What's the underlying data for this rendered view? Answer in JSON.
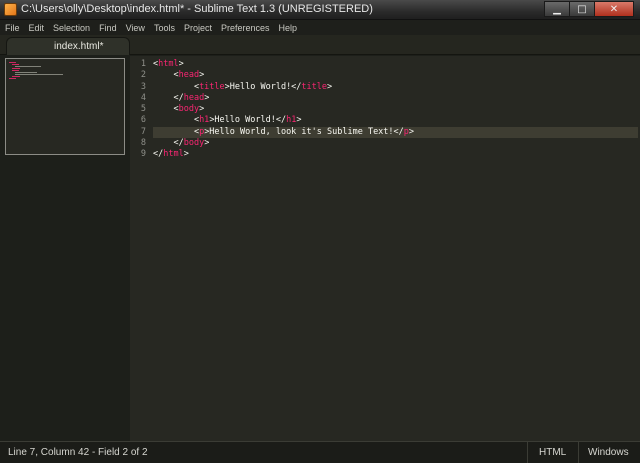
{
  "window": {
    "title": "C:\\Users\\olly\\Desktop\\index.html* - Sublime Text 1.3 (UNREGISTERED)",
    "app_icon": "sublime-icon"
  },
  "menu": [
    "File",
    "Edit",
    "Selection",
    "Find",
    "View",
    "Tools",
    "Project",
    "Preferences",
    "Help"
  ],
  "tab": {
    "label": "index.html*"
  },
  "editor": {
    "line_numbers": [
      "1",
      "2",
      "3",
      "4",
      "5",
      "6",
      "7",
      "8",
      "9"
    ],
    "current_line": 7,
    "lines": [
      [
        {
          "c": "p",
          "t": "<"
        },
        {
          "c": "t",
          "t": "html"
        },
        {
          "c": "p",
          "t": ">"
        }
      ],
      [
        {
          "c": "p",
          "t": "    <"
        },
        {
          "c": "t",
          "t": "head"
        },
        {
          "c": "p",
          "t": ">"
        }
      ],
      [
        {
          "c": "p",
          "t": "        <"
        },
        {
          "c": "t",
          "t": "title"
        },
        {
          "c": "p",
          "t": ">Hello World!</"
        },
        {
          "c": "t",
          "t": "title"
        },
        {
          "c": "p",
          "t": ">"
        }
      ],
      [
        {
          "c": "p",
          "t": "    </"
        },
        {
          "c": "t",
          "t": "head"
        },
        {
          "c": "p",
          "t": ">"
        }
      ],
      [
        {
          "c": "p",
          "t": "    <"
        },
        {
          "c": "t",
          "t": "body"
        },
        {
          "c": "p",
          "t": ">"
        }
      ],
      [
        {
          "c": "p",
          "t": "        <"
        },
        {
          "c": "t",
          "t": "h1"
        },
        {
          "c": "p",
          "t": ">Hello World!</"
        },
        {
          "c": "t",
          "t": "h1"
        },
        {
          "c": "p",
          "t": ">"
        }
      ],
      [
        {
          "c": "p",
          "t": "        <"
        },
        {
          "c": "t",
          "t": "p"
        },
        {
          "c": "p",
          "t": ">Hello World, look it's Sublime Text!</"
        },
        {
          "c": "t",
          "t": "p"
        },
        {
          "c": "p",
          "t": ">"
        }
      ],
      [
        {
          "c": "p",
          "t": "    </"
        },
        {
          "c": "t",
          "t": "body"
        },
        {
          "c": "p",
          "t": ">"
        }
      ],
      [
        {
          "c": "p",
          "t": "</"
        },
        {
          "c": "t",
          "t": "html"
        },
        {
          "c": "p",
          "t": ">"
        }
      ]
    ]
  },
  "status": {
    "position": "Line 7, Column 42 - Field 2 of 2",
    "syntax": "HTML",
    "line_endings": "Windows"
  },
  "colors": {
    "background": "#272822",
    "tag": "#f92672",
    "text": "#f8f8f2",
    "line_number": "#8f908a",
    "current_line": "#3e3d32"
  }
}
